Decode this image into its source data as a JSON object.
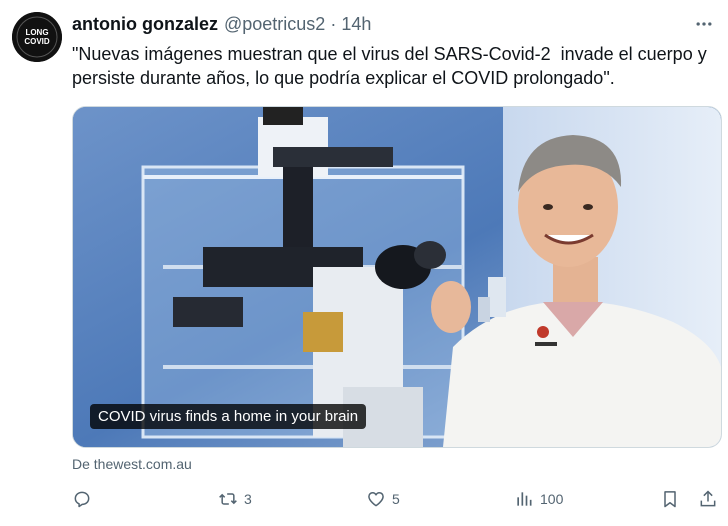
{
  "tweet": {
    "author_name": "antonio gonzalez",
    "handle": "@poetricus2",
    "separator": "·",
    "time": "14h",
    "text": "\"Nuevas imágenes muestran que el virus del SARS-Covid-2  invade el cuerpo y persiste durante años, lo que podría explicar el COVID prolongado\".",
    "avatar_text": {
      "line1": "LONG",
      "line2": "COVID"
    },
    "more_icon": "ellipsis-icon"
  },
  "media": {
    "caption": "COVID virus finds a home in your brain",
    "source": "De thewest.com.au"
  },
  "actions": {
    "reply": {
      "icon": "reply-icon",
      "count": ""
    },
    "retweet": {
      "icon": "retweet-icon",
      "count": "3"
    },
    "like": {
      "icon": "heart-icon",
      "count": "5"
    },
    "views": {
      "icon": "views-icon",
      "count": "100"
    },
    "bookmark": {
      "icon": "bookmark-icon"
    },
    "share": {
      "icon": "share-icon"
    }
  },
  "colors": {
    "text_primary": "#0f1419",
    "text_secondary": "#536471",
    "border": "#cfd9de"
  }
}
